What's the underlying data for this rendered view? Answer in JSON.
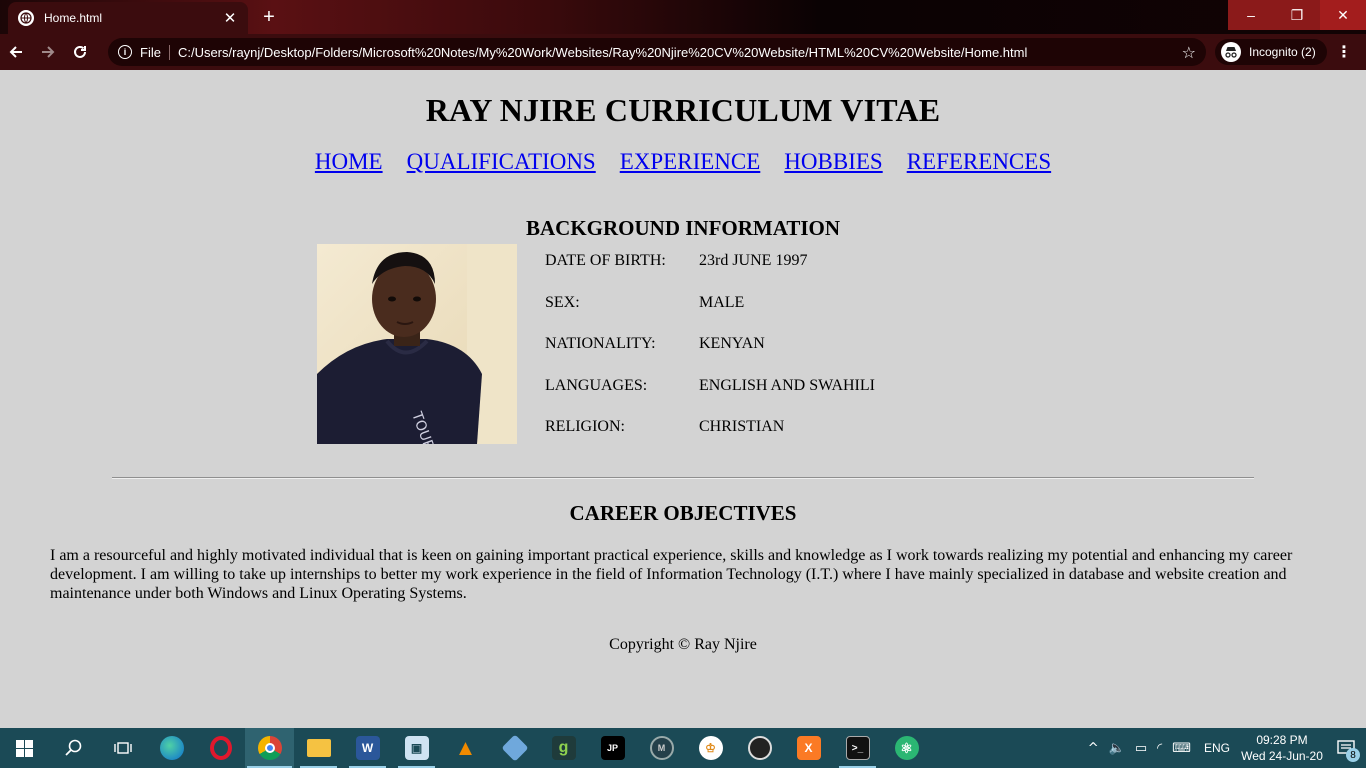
{
  "browser": {
    "tab_title": "Home.html",
    "tab_close": "✕",
    "new_tab": "+",
    "scheme_label": "File",
    "url": "C:/Users/raynj/Desktop/Folders/Microsoft%20Notes/My%20Work/Websites/Ray%20Njire%20CV%20Website/HTML%20CV%20Website/Home.html",
    "incognito_label": "Incognito (2)",
    "window_controls": {
      "minimize": "–",
      "restore": "❐",
      "close": "✕"
    },
    "theme_colors": {
      "frame": "#3b0c0e",
      "omnibox": "#1e0405"
    }
  },
  "page": {
    "title": "RAY NJIRE CURRICULUM VITAE",
    "nav": [
      "HOME",
      "QUALIFICATIONS",
      "EXPERIENCE",
      "HOBBIES",
      "REFERENCES"
    ],
    "background_heading": "BACKGROUND INFORMATION",
    "background": [
      {
        "label": "DATE OF BIRTH:",
        "value": "23rd JUNE 1997"
      },
      {
        "label": "SEX:",
        "value": "MALE"
      },
      {
        "label": "NATIONALITY:",
        "value": "KENYAN"
      },
      {
        "label": "LANGUAGES:",
        "value": "ENGLISH AND SWAHILI"
      },
      {
        "label": "RELIGION:",
        "value": "CHRISTIAN"
      }
    ],
    "career_heading": "CAREER OBJECTIVES",
    "career_text": "I am a resourceful and highly motivated individual that is keen on gaining important practical experience, skills and knowledge as I work towards realizing my potential and enhancing my career development. I am willing to take up internships to better my work experience in the field of Information Technology (I.T.) where I have mainly specialized in database and website creation and maintenance under both Windows and Linux Operating Systems.",
    "copyright": "Copyright © Ray Njire",
    "colors": {
      "background": "#d3d3d3",
      "link": "#0000ee"
    }
  },
  "taskbar": {
    "language": "ENG",
    "time": "09:28 PM",
    "date": "Wed 24-Jun-20",
    "notification_count": "8",
    "color": "#1b4a56"
  }
}
